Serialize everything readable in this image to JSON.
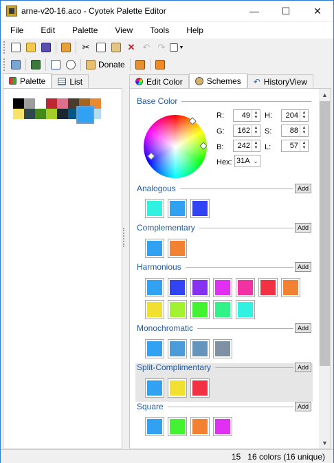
{
  "window": {
    "title": "arne-v20-16.aco - Cyotek Palette Editor"
  },
  "menu": [
    "File",
    "Edit",
    "Palette",
    "View",
    "Tools",
    "Help"
  ],
  "toolbar2": {
    "donate_label": "Donate"
  },
  "left_tabs": [
    {
      "label": "Palette"
    },
    {
      "label": "List"
    }
  ],
  "palette": {
    "row1": [
      "#000000",
      "#9d9d9d",
      "#ffffff",
      "#be2633",
      "#e06f8b",
      "#493c2b",
      "#a46422",
      "#eb8931"
    ],
    "row2": [
      "#f7e26b",
      "#2f484e",
      "#44891a",
      "#a3ce27",
      "#1b2632",
      "#005784",
      "#31a2f2",
      "#b2dcef"
    ],
    "selected_index": 14
  },
  "right_tabs": [
    {
      "label": "Edit Color"
    },
    {
      "label": "Schemes"
    },
    {
      "label": "HistoryView"
    }
  ],
  "base_color": {
    "title": "Base Color",
    "r_label": "R:",
    "r": "49",
    "g_label": "G:",
    "g": "162",
    "b_label": "B:",
    "b": "242",
    "h_label": "H:",
    "h": "204",
    "s_label": "S:",
    "s": "88",
    "l_label": "L:",
    "l": "57",
    "hex_label": "Hex:",
    "hex": "31A"
  },
  "schemes": {
    "analogous": {
      "title": "Analogous",
      "add": "Add",
      "colors": [
        "#31f2e0",
        "#31a2f2",
        "#3143f2"
      ]
    },
    "complementary": {
      "title": "Complementary",
      "add": "Add",
      "colors": [
        "#31a2f2",
        "#f28131"
      ]
    },
    "harmonious": {
      "title": "Harmonious",
      "add": "Add",
      "colors": [
        "#31a2f2",
        "#3143f2",
        "#8631f2",
        "#e031f2",
        "#f231a2",
        "#f23143",
        "#f28131",
        "#f2e031",
        "#a2f231",
        "#43f231",
        "#31f286",
        "#31f2e0"
      ]
    },
    "monochromatic": {
      "title": "Monochromatic",
      "add": "Add",
      "colors": [
        "#31a2f2",
        "#4b9bd8",
        "#6595bd",
        "#7f8fa4"
      ]
    },
    "split": {
      "title": "Split-Complimentary",
      "add": "Add",
      "colors": [
        "#31a2f2",
        "#f2e031",
        "#f23143"
      ]
    },
    "square": {
      "title": "Square",
      "add": "Add",
      "colors": [
        "#31a2f2",
        "#43f231",
        "#f28131",
        "#e031f2"
      ]
    }
  },
  "status": {
    "index": "15",
    "summary": "16 colors (16 unique)"
  }
}
